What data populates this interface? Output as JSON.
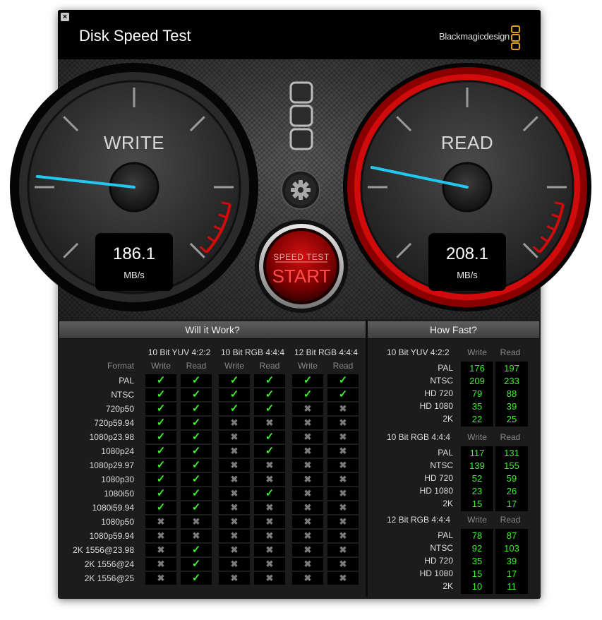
{
  "app": {
    "title": "Disk Speed Test",
    "brand": "Blackmagicdesign",
    "close_glyph": "×"
  },
  "write": {
    "label": "WRITE",
    "value": "186.1",
    "unit": "MB/s",
    "needle_fraction": 0.19
  },
  "read": {
    "label": "READ",
    "value": "208.1",
    "unit": "MB/s",
    "needle_fraction": 0.21
  },
  "start_button": {
    "top": "SPEED TEST",
    "label": "START"
  },
  "icons": {
    "settings": "gear-icon",
    "logo": "blackmagic-logo-icon"
  },
  "colors": {
    "accent_red": "#d10b0b",
    "needle": "#22c8f0",
    "ok_green": "#3cf02a"
  },
  "will_it_work": {
    "title": "Will it Work?",
    "format_header": "Format",
    "groups": [
      "10 Bit YUV 4:2:2",
      "10 Bit RGB 4:4:4",
      "12 Bit RGB 4:4:4"
    ],
    "sub_headers": [
      "Write",
      "Read"
    ],
    "rows": [
      {
        "format": "PAL",
        "checks": [
          1,
          1,
          1,
          1,
          1,
          1
        ]
      },
      {
        "format": "NTSC",
        "checks": [
          1,
          1,
          1,
          1,
          1,
          1
        ]
      },
      {
        "format": "720p50",
        "checks": [
          1,
          1,
          1,
          1,
          0,
          0
        ]
      },
      {
        "format": "720p59.94",
        "checks": [
          1,
          1,
          0,
          0,
          0,
          0
        ]
      },
      {
        "format": "1080p23.98",
        "checks": [
          1,
          1,
          0,
          1,
          0,
          0
        ]
      },
      {
        "format": "1080p24",
        "checks": [
          1,
          1,
          0,
          1,
          0,
          0
        ]
      },
      {
        "format": "1080p29.97",
        "checks": [
          1,
          1,
          0,
          0,
          0,
          0
        ]
      },
      {
        "format": "1080p30",
        "checks": [
          1,
          1,
          0,
          0,
          0,
          0
        ]
      },
      {
        "format": "1080i50",
        "checks": [
          1,
          1,
          0,
          1,
          0,
          0
        ]
      },
      {
        "format": "1080i59.94",
        "checks": [
          1,
          1,
          0,
          0,
          0,
          0
        ]
      },
      {
        "format": "1080p50",
        "checks": [
          0,
          0,
          0,
          0,
          0,
          0
        ]
      },
      {
        "format": "1080p59.94",
        "checks": [
          0,
          0,
          0,
          0,
          0,
          0
        ]
      },
      {
        "format": "2K 1556@23.98",
        "checks": [
          0,
          1,
          0,
          0,
          0,
          0
        ]
      },
      {
        "format": "2K 1556@24",
        "checks": [
          0,
          1,
          0,
          0,
          0,
          0
        ]
      },
      {
        "format": "2K 1556@25",
        "checks": [
          0,
          1,
          0,
          0,
          0,
          0
        ]
      }
    ]
  },
  "how_fast": {
    "title": "How Fast?",
    "sub_headers": [
      "Write",
      "Read"
    ],
    "groups": [
      {
        "name": "10 Bit YUV 4:2:2",
        "rows": [
          {
            "format": "PAL",
            "write": "176",
            "read": "197"
          },
          {
            "format": "NTSC",
            "write": "209",
            "read": "233"
          },
          {
            "format": "HD 720",
            "write": "79",
            "read": "88"
          },
          {
            "format": "HD 1080",
            "write": "35",
            "read": "39"
          },
          {
            "format": "2K",
            "write": "22",
            "read": "25"
          }
        ]
      },
      {
        "name": "10 Bit RGB 4:4:4",
        "rows": [
          {
            "format": "PAL",
            "write": "117",
            "read": "131"
          },
          {
            "format": "NTSC",
            "write": "139",
            "read": "155"
          },
          {
            "format": "HD 720",
            "write": "52",
            "read": "59"
          },
          {
            "format": "HD 1080",
            "write": "23",
            "read": "26"
          },
          {
            "format": "2K",
            "write": "15",
            "read": "17"
          }
        ]
      },
      {
        "name": "12 Bit RGB 4:4:4",
        "rows": [
          {
            "format": "PAL",
            "write": "78",
            "read": "87"
          },
          {
            "format": "NTSC",
            "write": "92",
            "read": "103"
          },
          {
            "format": "HD 720",
            "write": "35",
            "read": "39"
          },
          {
            "format": "HD 1080",
            "write": "15",
            "read": "17"
          },
          {
            "format": "2K",
            "write": "10",
            "read": "11"
          }
        ]
      }
    ]
  }
}
